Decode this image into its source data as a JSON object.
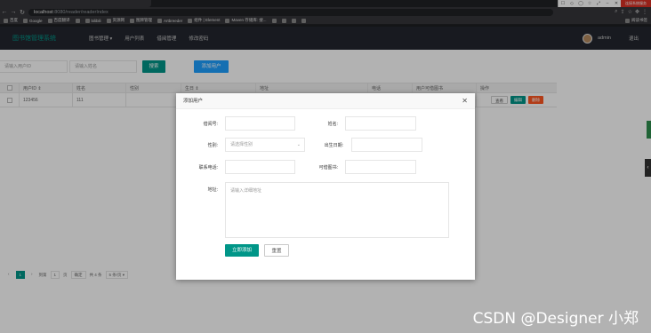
{
  "browser": {
    "url_host": "localhost",
    "url_path": ":8080/reader/readerIndex",
    "bookmarks": [
      "百度",
      "Google",
      "百度翻译",
      "",
      "bilibili",
      "资源网",
      "图牌管理",
      "Artbreeder",
      "组件 | Element",
      "Maven 存储库: 搜...",
      "",
      "",
      "",
      "",
      "",
      ""
    ],
    "bookmark_right": "阅读书签",
    "badge": "连接系统服务"
  },
  "app": {
    "brand": "图书馆管理系统",
    "menu": [
      "图书管理 ▾",
      "用户列表",
      "借阅管理",
      "修改密码"
    ],
    "user": "admin",
    "logout": "退出"
  },
  "search": {
    "id_placeholder": "请输入用户ID",
    "name_placeholder": "请输入姓名",
    "search_label": "搜索",
    "add_label": "添加用户"
  },
  "table": {
    "headers": [
      "用户ID ⇕",
      "姓名",
      "性别",
      "生日 ⇕",
      "地址",
      "电话",
      "用户可借图书",
      "操作"
    ],
    "rows": [
      {
        "id": "123456",
        "name": "111",
        "gender": "",
        "birthday": "",
        "address": "",
        "phone": "",
        "quota": ""
      }
    ],
    "actions": [
      "查看",
      "编辑",
      "删除"
    ]
  },
  "pager": {
    "prev": "‹",
    "page": "1",
    "next": "›",
    "goto_prefix": "到第",
    "goto_value": "1",
    "goto_suffix": "页",
    "confirm": "确定",
    "total": "共 4 条",
    "per_page": "5 条/页 ▾"
  },
  "modal": {
    "title": "添加用户",
    "close": "✕",
    "labels": {
      "card": "借阅号:",
      "name": "姓名:",
      "gender": "性别:",
      "birthday": "出生日期:",
      "phone": "联系电话:",
      "quota": "可借图书:",
      "address": "地址:"
    },
    "gender_placeholder": "请选择性别",
    "address_placeholder": "请输入详细地址",
    "submit": "立即添加",
    "reset": "重置"
  },
  "watermark": "CSDN @Designer 小郑",
  "colors": {
    "primary": "#009688",
    "blue": "#1e9fff",
    "danger": "#ff5722",
    "header": "#23262e"
  }
}
